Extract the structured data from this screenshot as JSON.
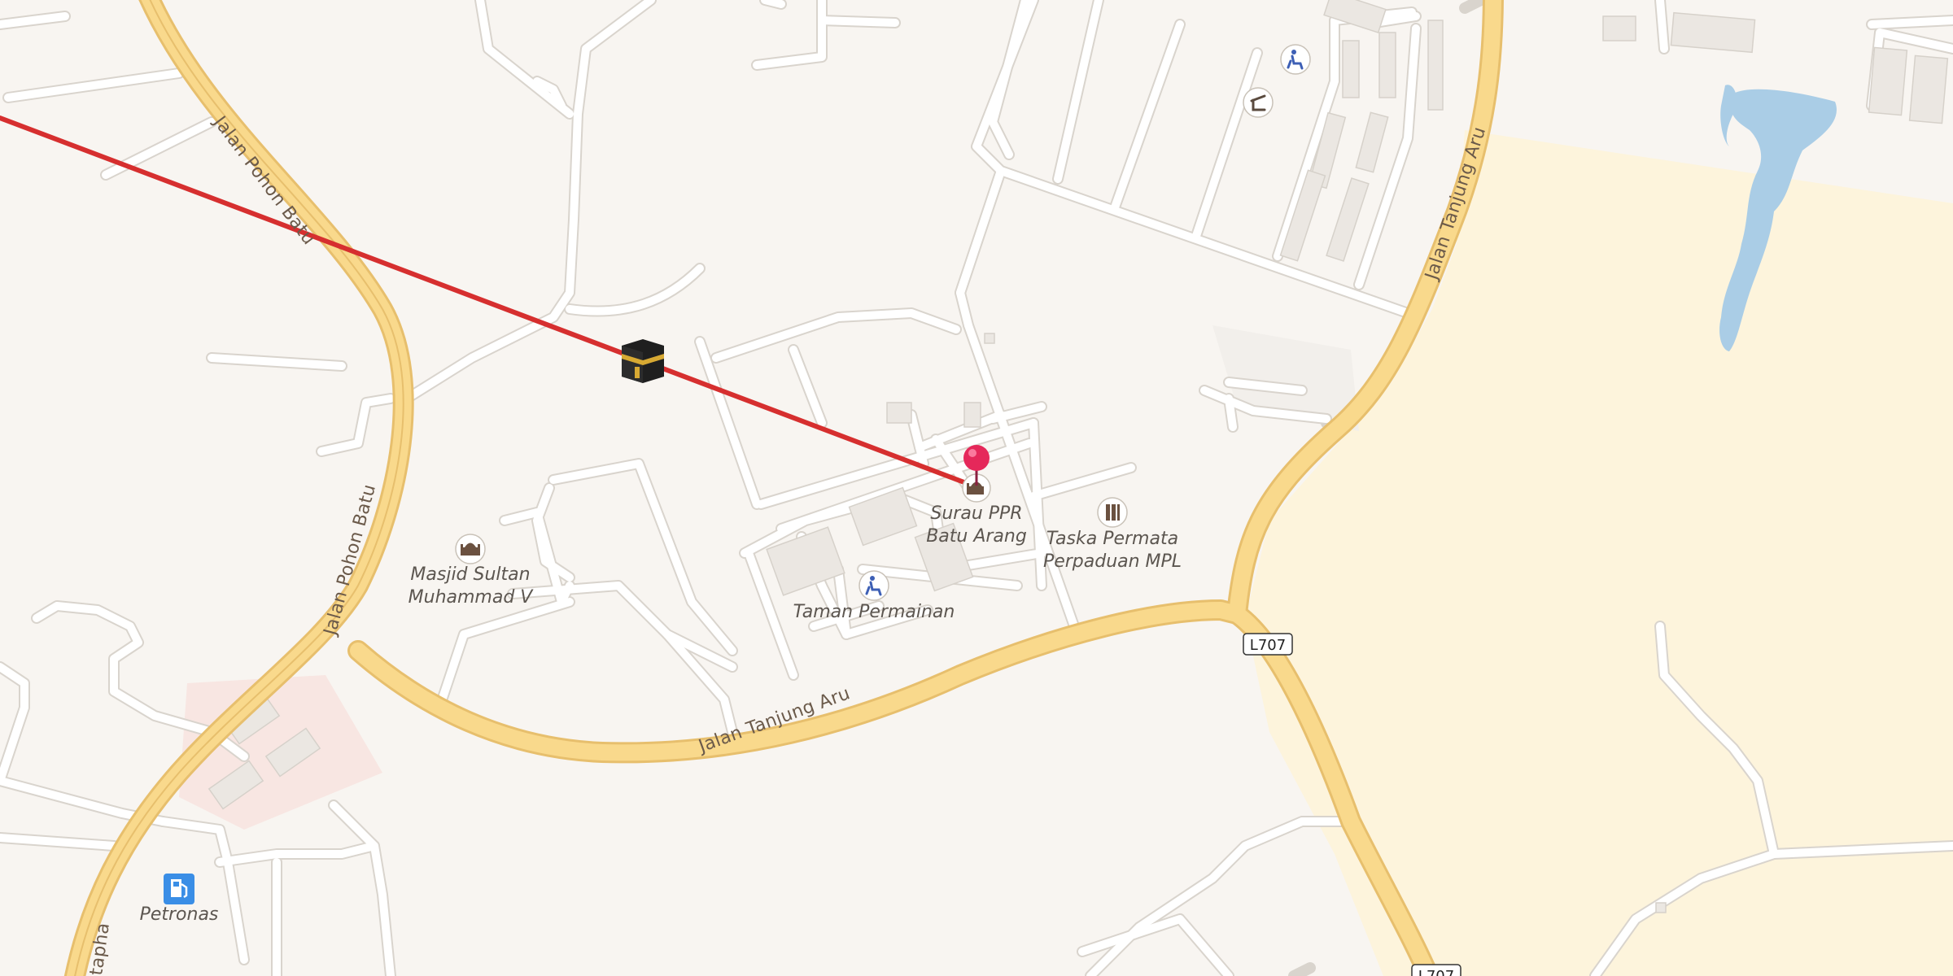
{
  "map": {
    "colors": {
      "land": "#f8f5f1",
      "minor_road": "#ffffff",
      "minor_road_casing": "#dcd7d0",
      "major_road": "#f9d98c",
      "major_road_casing": "#e7bf6d",
      "water": "#aacde6",
      "field": "#fdf4dc",
      "route_line": "#d62f2f",
      "pin": "#e5285a"
    },
    "road_labels": {
      "pohon_batu_north": "Jalan Pohon Batu",
      "pohon_batu_south": "Jalan Pohon Batu",
      "tanjung_aru_south": "Jalan Tanjung Aru",
      "tanjung_aru_east": "Jalan Tanjung Aru",
      "mustapha_partial": "tapha"
    },
    "route_shields": {
      "l707_a": "L707",
      "l707_b": "L707"
    },
    "pois": {
      "surau": {
        "name_line1": "Surau PPR",
        "name_line2": "Batu Arang",
        "icon": "mosque-icon"
      },
      "taska": {
        "name_line1": "Taska Permata",
        "name_line2": "Perpaduan MPL",
        "icon": "school-icon"
      },
      "taman": {
        "name": "Taman Permainan",
        "icon": "playground-icon"
      },
      "masjid": {
        "name_line1": "Masjid Sultan",
        "name_line2": "Muhammad V",
        "icon": "mosque-icon"
      },
      "petronas": {
        "name": "Petronas",
        "icon": "fuel-station-icon"
      },
      "kaaba": {
        "icon": "kaaba-icon"
      },
      "playground_north": {
        "icon": "playground-icon"
      },
      "shelter": {
        "icon": "shelter-icon"
      },
      "pin": {
        "icon": "location-pin-icon"
      }
    }
  }
}
